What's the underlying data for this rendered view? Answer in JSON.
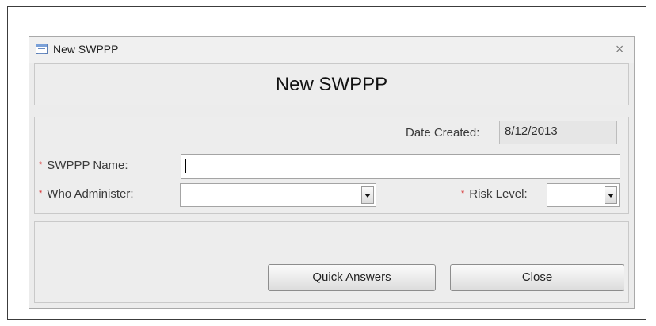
{
  "window": {
    "title": "New SWPPP",
    "icon": "form-icon",
    "close_glyph": "⨯"
  },
  "header": {
    "title": "New SWPPP"
  },
  "form": {
    "date_created": {
      "label": "Date Created:",
      "value": "8/12/2013"
    },
    "swppp_name": {
      "required_mark": "*",
      "label": "SWPPP Name:",
      "value": ""
    },
    "who_administer": {
      "required_mark": "*",
      "label": "Who Administer:",
      "value": ""
    },
    "risk_level": {
      "required_mark": "*",
      "label": "Risk Level:",
      "value": ""
    }
  },
  "buttons": {
    "quick_answers": "Quick Answers",
    "close": "Close"
  },
  "colors": {
    "required": "#d62a2a",
    "background": "#ececec",
    "border": "#a9a9a9"
  }
}
